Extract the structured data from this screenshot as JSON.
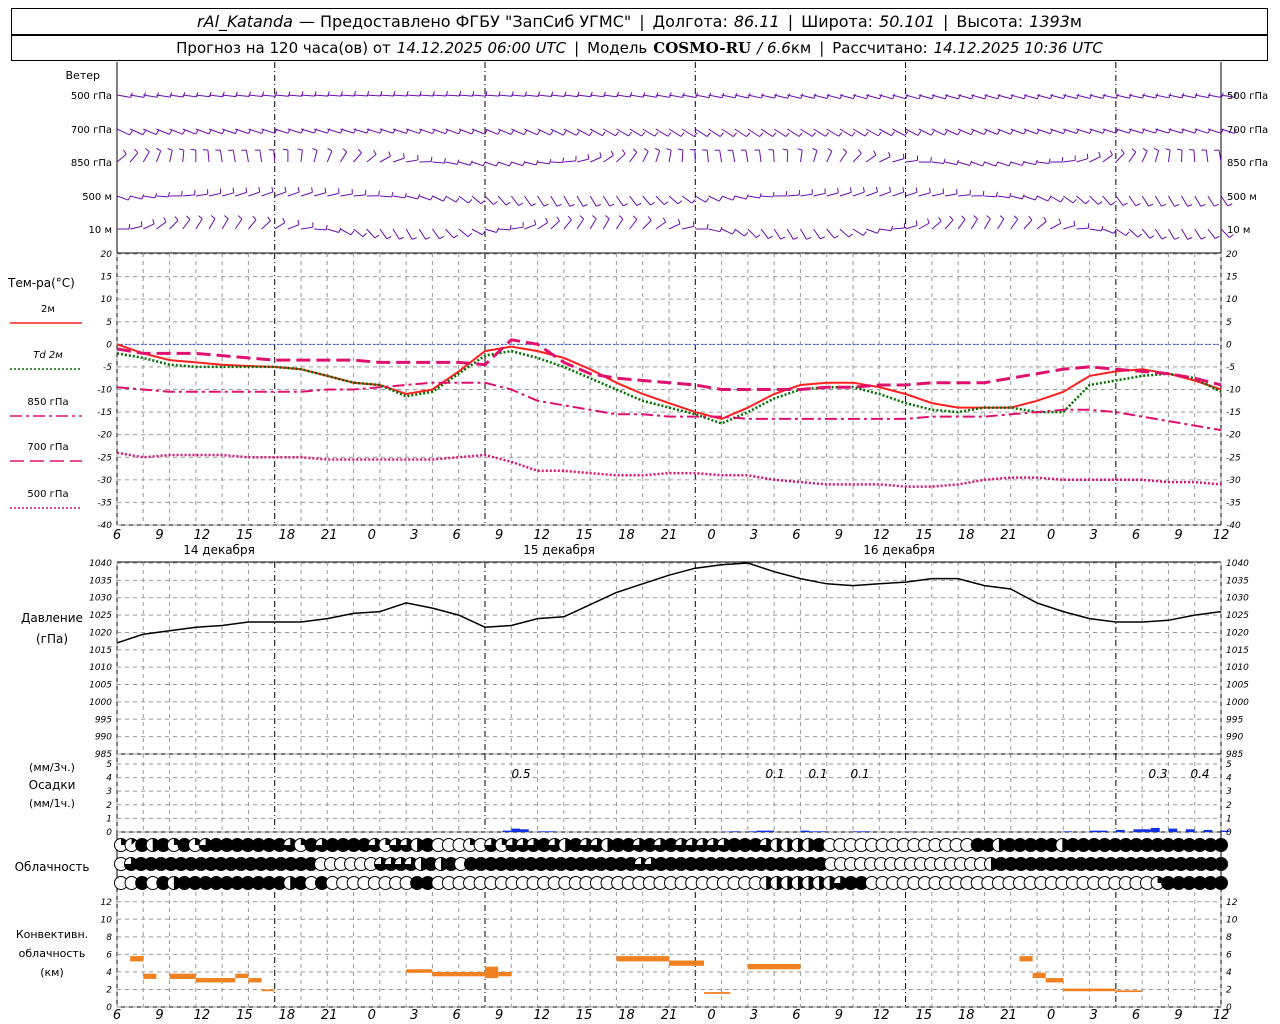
{
  "header": {
    "station": "rAl_Katanda",
    "provided": "— Предоставлено ФГБУ \"ЗапСиб УГМС\"",
    "lon_label": "Долгота:",
    "lon_value": "86.11",
    "lat_label": "Широта:",
    "lat_value": "50.101",
    "alt_label": "Высота:",
    "alt_value": "1393",
    "alt_unit": "м",
    "forecast_prefix": "Прогноз на 120 часа(ов) от",
    "forecast_start": "14.12.2025 06:00 UTC",
    "model_label": "Модель",
    "model_name": "COSMO-RU",
    "model_res": "/ 6.6",
    "model_res_unit": "км",
    "calc_label": "Рассчитано:",
    "calc_time": "14.12.2025 10:36 UTC"
  },
  "time_axis": {
    "hour_labels": [
      "6",
      "9",
      "12",
      "15",
      "18",
      "21",
      "0",
      "3",
      "6",
      "9",
      "12",
      "15",
      "18",
      "21",
      "0",
      "3",
      "6",
      "9",
      "12",
      "15",
      "18",
      "21",
      "0",
      "3",
      "6",
      "9",
      "12"
    ],
    "day_labels": [
      "14 декабря",
      "15 декабря",
      "16 декабря"
    ]
  },
  "wind_panel": {
    "title": "Ветер",
    "levels": [
      "500 гПа",
      "700 гПа",
      "850 гПа",
      "500 м",
      "10 м"
    ],
    "color": "#6a0dad"
  },
  "temp_panel": {
    "title": "Тем-ра(°C)",
    "legend": [
      {
        "label": "2м",
        "color": "#ff2020",
        "style": "solid"
      },
      {
        "label": "Td 2м",
        "color": "#007000",
        "style": "dotted"
      },
      {
        "label": "850 гПа",
        "color": "#e0106e",
        "style": "dashdot"
      },
      {
        "label": "700 гПа",
        "color": "#e0106e",
        "style": "longdash"
      },
      {
        "label": "500 гПа",
        "color": "#e0106e",
        "style": "dotted"
      }
    ],
    "ticks": [
      "20",
      "15",
      "10",
      "5",
      "0",
      "-5",
      "-10",
      "-15",
      "-20",
      "-25",
      "-30",
      "-35",
      "-40"
    ]
  },
  "pressure_panel": {
    "title": "Давление",
    "unit": "(гПа)",
    "ticks": [
      "1040",
      "1035",
      "1030",
      "1025",
      "1020",
      "1015",
      "1010",
      "1005",
      "1000",
      "995",
      "990",
      "985"
    ]
  },
  "precip_panel": {
    "unit_top": "(мм/3ч.)",
    "title": "Осадки",
    "unit_bottom": "(мм/1ч.)",
    "ticks": [
      "5",
      "4",
      "3",
      "2",
      "1",
      "0"
    ],
    "annotations": [
      "0.5",
      "0.1",
      "0.1",
      "0.1",
      "0.3",
      "0.4"
    ],
    "color": "#1030e0"
  },
  "cloud_panel": {
    "title": "Облачность"
  },
  "conv_panel": {
    "title_line1": "Конвективн.",
    "title_line2": "облачность",
    "unit": "(км)",
    "ticks": [
      "12",
      "10",
      "8",
      "6",
      "4",
      "2",
      "0"
    ],
    "color": "#f08020"
  },
  "chart_data": [
    {
      "type": "line",
      "name": "temperature",
      "x_hours": [
        0,
        3,
        6,
        9,
        12,
        15,
        18,
        21,
        24,
        27,
        30,
        33,
        36,
        39,
        42,
        45,
        48,
        51,
        54,
        57,
        60,
        63,
        66,
        69,
        72,
        75,
        78,
        81,
        84,
        87,
        90,
        93,
        96,
        99,
        102,
        105,
        108,
        111,
        114,
        117,
        120,
        123,
        126
      ],
      "ylim": [
        -40,
        20
      ],
      "series": [
        {
          "name": "2м",
          "values": [
            0,
            -2,
            -3.5,
            -4,
            -4.5,
            -4.8,
            -5,
            -5.5,
            -7,
            -8.5,
            -9,
            -11,
            -10,
            -6,
            -1.5,
            -0.5,
            -1.5,
            -3,
            -5.5,
            -8.5,
            -11,
            -13,
            -15,
            -16.5,
            -14,
            -11,
            -9,
            -8.5,
            -8.5,
            -9.5,
            -11,
            -13,
            -14,
            -14,
            -14,
            -12.5,
            -10.5,
            -7,
            -6,
            -5.5,
            -6.5,
            -8,
            -10
          ]
        },
        {
          "name": "Td 2м",
          "values": [
            -2,
            -3,
            -4.5,
            -5,
            -5,
            -5,
            -5,
            -5.5,
            -7,
            -8.5,
            -9,
            -11.5,
            -10.5,
            -6.5,
            -2.5,
            -1.5,
            -3,
            -5,
            -7.5,
            -10,
            -12.5,
            -14,
            -15.5,
            -17.5,
            -15,
            -12,
            -10,
            -9.5,
            -9.5,
            -11,
            -13,
            -14.5,
            -15,
            -14,
            -14,
            -15,
            -15,
            -9,
            -8,
            -7,
            -6.5,
            -7.5,
            -10.5
          ]
        },
        {
          "name": "850 гПа",
          "values": [
            -9.5,
            -10,
            -10.5,
            -10.5,
            -10.5,
            -10.5,
            -10.5,
            -10.5,
            -10,
            -10,
            -9.5,
            -9,
            -8.5,
            -8.5,
            -8.5,
            -10,
            -12.5,
            -13.5,
            -14.5,
            -15.5,
            -15.5,
            -16,
            -16,
            -16,
            -16.5,
            -16.5,
            -16.5,
            -16.5,
            -16.5,
            -16.5,
            -16.5,
            -16,
            -16,
            -16,
            -15.5,
            -15,
            -14.5,
            -14.5,
            -15,
            -16,
            -17,
            -18,
            -19
          ]
        },
        {
          "name": "700 гПа",
          "values": [
            -1,
            -2,
            -2,
            -2,
            -2.5,
            -3,
            -3.5,
            -3.5,
            -3.5,
            -3.5,
            -4,
            -4,
            -4,
            -4,
            -4.5,
            1,
            0,
            -4,
            -6.5,
            -7.5,
            -8,
            -8.5,
            -9,
            -10,
            -10,
            -10,
            -10,
            -9.5,
            -9.5,
            -9,
            -9,
            -8.5,
            -8.5,
            -8.5,
            -7.5,
            -6.5,
            -5.5,
            -5,
            -5.5,
            -6,
            -6.5,
            -7.5,
            -9
          ]
        },
        {
          "name": "500 гПа",
          "values": [
            -24,
            -25,
            -24.5,
            -24.5,
            -24.5,
            -25,
            -25,
            -25,
            -25.5,
            -25.5,
            -25.5,
            -25.5,
            -25.5,
            -25,
            -24.5,
            -26,
            -28,
            -28,
            -28.5,
            -29,
            -29,
            -28.5,
            -28.5,
            -29,
            -29,
            -30,
            -30.5,
            -31,
            -31,
            -31,
            -31.5,
            -31.5,
            -31,
            -30,
            -29.5,
            -29.5,
            -30,
            -30,
            -30,
            -30,
            -30.5,
            -30.5,
            -31
          ]
        }
      ]
    },
    {
      "type": "line",
      "name": "pressure",
      "x_hours": [
        0,
        3,
        6,
        9,
        12,
        15,
        18,
        21,
        24,
        27,
        30,
        33,
        36,
        39,
        42,
        45,
        48,
        51,
        54,
        57,
        60,
        63,
        66,
        69,
        72,
        75,
        78,
        81,
        84,
        87,
        90,
        93,
        96,
        99,
        102,
        105,
        108,
        111,
        114,
        117,
        120,
        123,
        126
      ],
      "ylim": [
        985,
        1040
      ],
      "values": [
        1017,
        1019.5,
        1020.5,
        1021.5,
        1022,
        1023,
        1023,
        1023,
        1024,
        1025.5,
        1026,
        1028.5,
        1027,
        1025,
        1021.5,
        1022,
        1024,
        1024.5,
        1028,
        1031.5,
        1034,
        1036.5,
        1038.5,
        1039.5,
        1040,
        1037.5,
        1035.5,
        1034,
        1033.5,
        1034,
        1034.5,
        1035.5,
        1035.5,
        1033.5,
        1032.5,
        1028.5,
        1026,
        1024,
        1023,
        1023,
        1023.5,
        1025,
        1026
      ]
    },
    {
      "type": "bar",
      "name": "precipitation",
      "unit": "мм/1ч.",
      "ylim": [
        0,
        5
      ],
      "x_hours": [
        44,
        45,
        46,
        48,
        49,
        69,
        70,
        72,
        73,
        74,
        78,
        79,
        80,
        84,
        85,
        90,
        108,
        111,
        112,
        114,
        116,
        117,
        118,
        120,
        122,
        124,
        126
      ],
      "values": [
        0.1,
        0.25,
        0.2,
        0.05,
        0.05,
        0.02,
        0.05,
        0.05,
        0.1,
        0.1,
        0.1,
        0.05,
        0.05,
        0.05,
        0.05,
        0.02,
        0.05,
        0.1,
        0.1,
        0.15,
        0.2,
        0.2,
        0.3,
        0.25,
        0.2,
        0.15,
        0.1
      ]
    },
    {
      "type": "bar",
      "name": "convective_cloud",
      "unit": "км",
      "ylim": [
        0,
        13
      ],
      "segments": [
        {
          "x0": 1.5,
          "x1": 3,
          "bottom": 5.2,
          "top": 5.8
        },
        {
          "x0": 3,
          "x1": 4.5,
          "bottom": 3.2,
          "top": 3.8
        },
        {
          "x0": 6,
          "x1": 9,
          "bottom": 3.2,
          "top": 3.8
        },
        {
          "x0": 9,
          "x1": 13.5,
          "bottom": 2.8,
          "top": 3.3
        },
        {
          "x0": 13.5,
          "x1": 15,
          "bottom": 3.3,
          "top": 3.8
        },
        {
          "x0": 15,
          "x1": 16.5,
          "bottom": 2.8,
          "top": 3.3
        },
        {
          "x0": 16.5,
          "x1": 18,
          "bottom": 1.8,
          "top": 2.0
        },
        {
          "x0": 33,
          "x1": 36,
          "bottom": 3.9,
          "top": 4.3
        },
        {
          "x0": 36,
          "x1": 42,
          "bottom": 3.5,
          "top": 4.0
        },
        {
          "x0": 42,
          "x1": 43.5,
          "bottom": 3.3,
          "top": 4.6
        },
        {
          "x0": 43.5,
          "x1": 45,
          "bottom": 3.5,
          "top": 4.0
        },
        {
          "x0": 57,
          "x1": 63,
          "bottom": 5.2,
          "top": 5.8
        },
        {
          "x0": 63,
          "x1": 67,
          "bottom": 4.7,
          "top": 5.3
        },
        {
          "x0": 67,
          "x1": 70,
          "bottom": 1.5,
          "top": 1.7
        },
        {
          "x0": 72,
          "x1": 78,
          "bottom": 4.3,
          "top": 4.9
        },
        {
          "x0": 103,
          "x1": 104.5,
          "bottom": 5.2,
          "top": 5.8
        },
        {
          "x0": 104.5,
          "x1": 106,
          "bottom": 3.3,
          "top": 3.9
        },
        {
          "x0": 106,
          "x1": 108,
          "bottom": 2.8,
          "top": 3.3
        },
        {
          "x0": 108,
          "x1": 114,
          "bottom": 1.8,
          "top": 2.1
        },
        {
          "x0": 114,
          "x1": 117,
          "bottom": 1.7,
          "top": 1.9
        }
      ]
    },
    {
      "type": "table",
      "name": "cloud_cover_octas",
      "rows": [
        [
          2,
          1,
          8,
          4,
          8,
          2,
          8,
          2,
          6,
          8,
          8,
          8,
          8,
          8,
          8,
          8,
          6,
          2,
          8,
          6,
          8,
          8,
          8,
          8,
          6,
          2,
          6,
          6,
          4,
          8,
          0,
          0,
          0,
          2,
          0,
          6,
          2,
          6,
          6,
          6,
          8,
          6,
          4,
          8,
          6,
          6,
          4,
          8,
          8,
          6,
          8,
          6,
          8,
          6,
          6,
          6,
          6,
          6,
          8,
          8,
          8,
          6,
          4,
          4,
          4,
          4,
          8,
          0,
          0,
          0,
          0,
          0,
          0,
          0,
          0,
          0,
          0,
          0,
          0,
          0,
          0,
          8,
          8,
          4,
          8,
          8,
          8,
          8,
          8,
          4,
          8,
          8,
          8,
          8,
          8,
          8,
          8,
          8,
          8,
          8,
          8,
          8,
          8,
          8,
          8
        ],
        [
          0,
          6,
          8,
          8,
          8,
          8,
          8,
          8,
          8,
          8,
          8,
          8,
          8,
          8,
          8,
          8,
          8,
          8,
          8,
          8,
          0,
          0,
          0,
          0,
          0,
          0,
          6,
          6,
          6,
          6,
          4,
          8,
          4,
          8,
          0,
          8,
          8,
          8,
          8,
          8,
          8,
          8,
          8,
          8,
          8,
          8,
          8,
          8,
          8,
          8,
          8,
          8,
          6,
          6,
          8,
          8,
          8,
          8,
          8,
          8,
          8,
          8,
          8,
          8,
          8,
          8,
          8,
          8,
          8,
          8,
          8,
          0,
          0,
          0,
          0,
          0,
          0,
          0,
          0,
          0,
          0,
          0,
          0,
          0,
          0,
          0,
          0,
          4,
          8,
          8,
          8,
          8,
          8,
          8,
          8,
          8,
          8,
          8,
          8,
          8,
          8,
          8,
          8,
          8,
          8,
          8,
          8,
          8,
          8,
          8,
          8
        ],
        [
          0,
          0,
          8,
          0,
          8,
          4,
          8,
          8,
          8,
          8,
          8,
          8,
          8,
          8,
          8,
          8,
          4,
          8,
          0,
          8,
          0,
          0,
          0,
          0,
          0,
          0,
          0,
          0,
          8,
          8,
          0,
          0,
          0,
          0,
          0,
          0,
          0,
          0,
          0,
          0,
          0,
          0,
          0,
          0,
          0,
          0,
          0,
          0,
          0,
          0,
          0,
          0,
          0,
          0,
          0,
          0,
          0,
          0,
          0,
          0,
          0,
          4,
          4,
          4,
          4,
          4,
          4,
          4,
          6,
          8,
          8,
          0,
          0,
          0,
          0,
          0,
          0,
          0,
          0,
          0,
          0,
          0,
          0,
          0,
          0,
          0,
          0,
          0,
          0,
          0,
          0,
          0,
          0,
          0,
          0,
          0,
          0,
          0,
          2,
          8,
          8,
          8,
          8,
          8,
          8
        ]
      ]
    }
  ]
}
